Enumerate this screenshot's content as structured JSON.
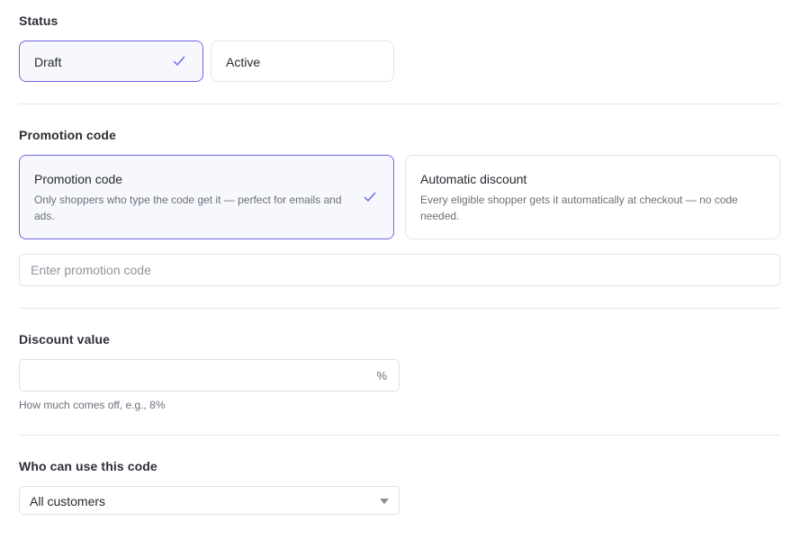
{
  "status": {
    "title": "Status",
    "options": [
      {
        "label": "Draft",
        "selected": true
      },
      {
        "label": "Active",
        "selected": false
      }
    ]
  },
  "promotion": {
    "title": "Promotion code",
    "cards": [
      {
        "title": "Promotion code",
        "description": "Only shoppers who type the code get it — perfect for emails and ads.",
        "selected": true
      },
      {
        "title": "Automatic discount",
        "description": "Every eligible shopper gets it automatically at checkout — no code needed.",
        "selected": false
      }
    ],
    "code_input": {
      "value": "",
      "placeholder": "Enter promotion code"
    }
  },
  "discount": {
    "title": "Discount value",
    "input": {
      "value": "",
      "placeholder": ""
    },
    "suffix": "%",
    "helper": "How much comes off, e.g., 8%"
  },
  "eligibility": {
    "title": "Who can use this code",
    "selected": "All customers"
  },
  "colors": {
    "accent": "#6f67e4",
    "selected_bg": "#f7f7fe",
    "border": "#e4e5e9"
  },
  "icons": {
    "check": "check-icon",
    "dropdown": "chevron-down-icon"
  }
}
